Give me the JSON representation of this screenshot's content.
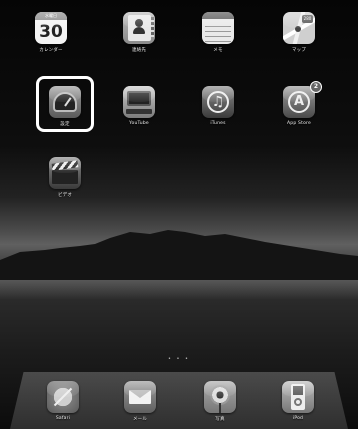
{
  "home_screen": {
    "apps": [
      {
        "id": "calendar",
        "label": "カレンダー",
        "icon": "calendar-icon",
        "day_number": "30",
        "day_of_week": "水曜日"
      },
      {
        "id": "contacts",
        "label": "連絡先",
        "icon": "contacts-icon"
      },
      {
        "id": "notes",
        "label": "メモ",
        "icon": "notes-icon"
      },
      {
        "id": "maps",
        "label": "マップ",
        "icon": "maps-icon",
        "sign_text": "280"
      },
      {
        "id": "settings",
        "label": "設定",
        "icon": "settings-icon"
      },
      {
        "id": "youtube",
        "label": "YouTube",
        "icon": "youtube-icon"
      },
      {
        "id": "itunes",
        "label": "iTunes",
        "icon": "itunes-icon"
      },
      {
        "id": "app_store",
        "label": "App Store",
        "icon": "app-store-icon",
        "badge": "2"
      },
      {
        "id": "videos",
        "label": "ビデオ",
        "icon": "videos-icon"
      }
    ],
    "page_indicator": "• • •"
  },
  "dock": {
    "apps": [
      {
        "id": "safari",
        "label": "Safari",
        "icon": "safari-icon"
      },
      {
        "id": "mail",
        "label": "メール",
        "icon": "mail-icon"
      },
      {
        "id": "photos",
        "label": "写真",
        "icon": "photos-icon"
      },
      {
        "id": "ipod",
        "label": "iPod",
        "icon": "ipod-icon"
      }
    ]
  },
  "highlight": {
    "target": "settings",
    "color": "#ffffff"
  }
}
